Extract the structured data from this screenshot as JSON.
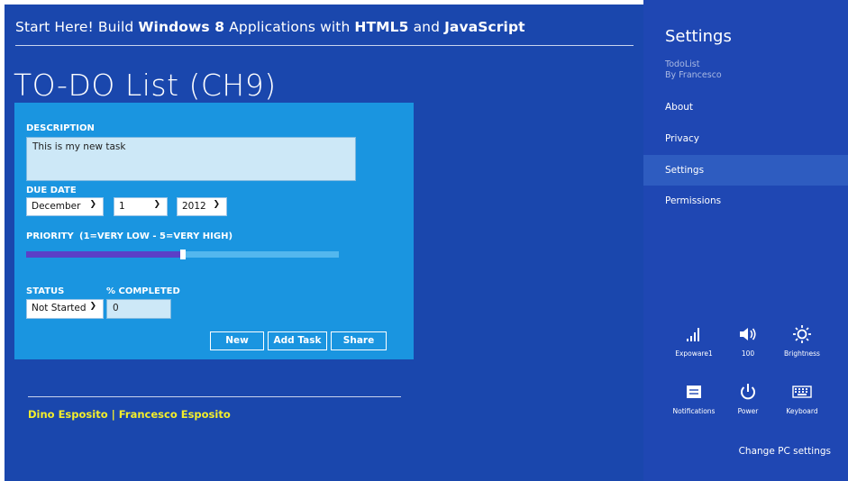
{
  "app": {
    "banner": {
      "prefix": "Start Here! Build ",
      "bold1": "Windows 8",
      "mid": " Applications with ",
      "bold2": "HTML5",
      "and": " and ",
      "bold3": "JavaScript"
    },
    "title": "TO-DO List (CH9)",
    "form": {
      "description_label": "DESCRIPTION",
      "description_value": "This is my new task",
      "due_date_label": "DUE DATE",
      "month": "December",
      "day": "1",
      "year": "2012",
      "priority_label": "PRIORITY",
      "priority_hint": "(1=VERY LOW - 5=VERY HIGH)",
      "priority_fraction": 0.5,
      "status_label": "STATUS",
      "status_value": "Not Started",
      "completed_label": "% COMPLETED",
      "completed_value": "0",
      "buttons": {
        "new": "New",
        "add": "Add Task",
        "share": "Share"
      }
    },
    "footer": "Dino Esposito | Francesco Esposito"
  },
  "settings_pane": {
    "title": "Settings",
    "app_name": "TodoList",
    "app_author": "By Francesco",
    "items": [
      "About",
      "Privacy",
      "Settings",
      "Permissions"
    ],
    "active_item": "Settings",
    "tiles": [
      {
        "icon": "network-icon",
        "label": "Expoware1"
      },
      {
        "icon": "volume-icon",
        "label": "100"
      },
      {
        "icon": "brightness-icon",
        "label": "Brightness"
      },
      {
        "icon": "notifications-icon",
        "label": "Notifications"
      },
      {
        "icon": "power-icon",
        "label": "Power"
      },
      {
        "icon": "keyboard-icon",
        "label": "Keyboard"
      }
    ],
    "change_pc_settings": "Change PC settings"
  },
  "colors": {
    "app_bg": "#1a47ad",
    "card_bg": "#1a95e0",
    "pane_bg": "#1f47b3",
    "footer_text": "#f3ee2b",
    "slider_fill": "#5b3fc7"
  }
}
